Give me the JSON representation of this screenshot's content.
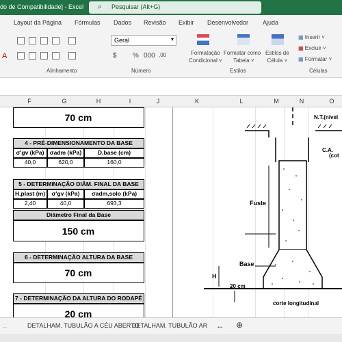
{
  "titlebar": {
    "title": "do de Compatibilidade]  -  Excel",
    "search_placeholder": "Pesquisar (Alt+G)"
  },
  "menu": [
    "Layout da Página",
    "Fórmulas",
    "Dados",
    "Revisão",
    "Exibir",
    "Desenvolvedor",
    "Ajuda"
  ],
  "ribbon": {
    "number_format": "Geral",
    "groups": {
      "alignment": "Alinhamento",
      "number": "Número",
      "styles": "Estilos",
      "cells": "Células"
    },
    "styles_buttons": [
      "Formatação\nCondicional",
      "Formatar como\nTabela",
      "Estilos de\nCélula"
    ],
    "cells_buttons": [
      "Inserir",
      "Excluir",
      "Formatar"
    ]
  },
  "columns": [
    "F",
    "G",
    "H",
    "I",
    "J",
    "K",
    "L",
    "M",
    "N",
    "O"
  ],
  "sheet": {
    "top_value": "70 cm",
    "section4": {
      "title": "4 - PRÉ-DIMENSIONAMENTO DA BASE",
      "headers": [
        "σ'gv (kPa)",
        "σadm (kPa)",
        "D,base (cm)"
      ],
      "values": [
        "40,0",
        "620,0",
        "160,0"
      ]
    },
    "section5": {
      "title": "5 - DETERMINAÇÃO DIÂM. FINAL DA BASE",
      "headers": [
        "H,plast (m)",
        "σ'gv (kPa)",
        "σadm,solo (kPa)"
      ],
      "values": [
        "2,40",
        "40,0",
        "693,3"
      ],
      "sub_title": "Diâmetro Final da Base",
      "result": "150 cm"
    },
    "section6": {
      "title": "6 - DETERMINAÇÃO ALTURA DA BASE",
      "result": "70 cm"
    },
    "section7": {
      "title": "7 - DETERMINAÇÃO DA ALTURA DO RODAPÉ",
      "result": "20 cm"
    }
  },
  "drawing": {
    "labels": {
      "nt": "N.T.(nível",
      "ca": "C.A.",
      "cot": "(cot",
      "fuste": "Fuste",
      "base": "Base",
      "h": "H",
      "dim": "20 cm",
      "corte": "corte longitudinal"
    }
  },
  "tabs": {
    "tab1": "DETALHAM. TUBULÃO A CÉU ABERTO",
    "tab2": "DETALHAM. TUBULÃO AR",
    "more": "..."
  }
}
